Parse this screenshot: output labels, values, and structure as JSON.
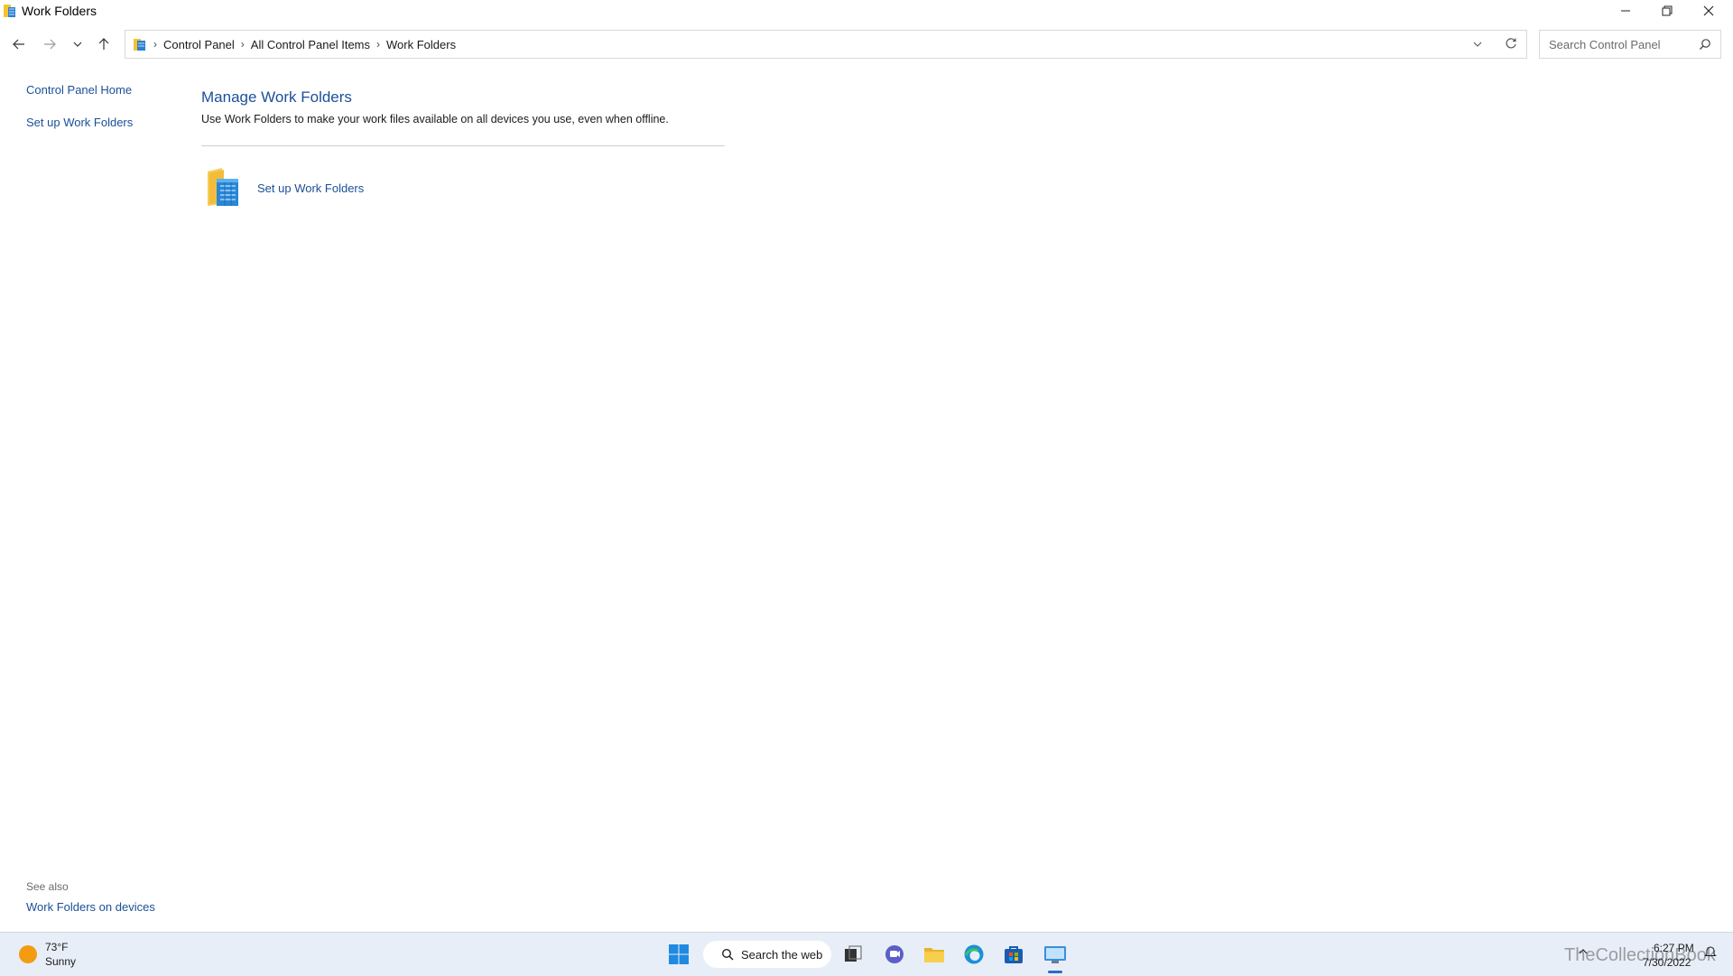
{
  "window": {
    "title": "Work Folders",
    "controls": {
      "minimize": "minimize-icon",
      "maximize": "restore-icon",
      "close": "close-icon"
    }
  },
  "address_bar": {
    "breadcrumbs": [
      "Control Panel",
      "All Control Panel Items",
      "Work Folders"
    ],
    "search_placeholder": "Search Control Panel"
  },
  "left_nav": {
    "items": [
      "Control Panel Home",
      "Set up Work Folders"
    ],
    "see_also_heading": "See also",
    "see_also_items": [
      "Work Folders on devices"
    ]
  },
  "main": {
    "title": "Manage Work Folders",
    "description": "Use Work Folders to make your work files available on all devices you use, even when offline.",
    "action_link": "Set up Work Folders"
  },
  "taskbar": {
    "weather": {
      "temp": "73°F",
      "condition": "Sunny"
    },
    "search_label": "Search the web",
    "time": "6:27 PM",
    "date": "7/30/2022",
    "watermark": "TheCollectionBook"
  },
  "colors": {
    "link": "#1b4f9a",
    "taskbar_bg": "#e8eef8",
    "accent": "#2b6cc4"
  }
}
